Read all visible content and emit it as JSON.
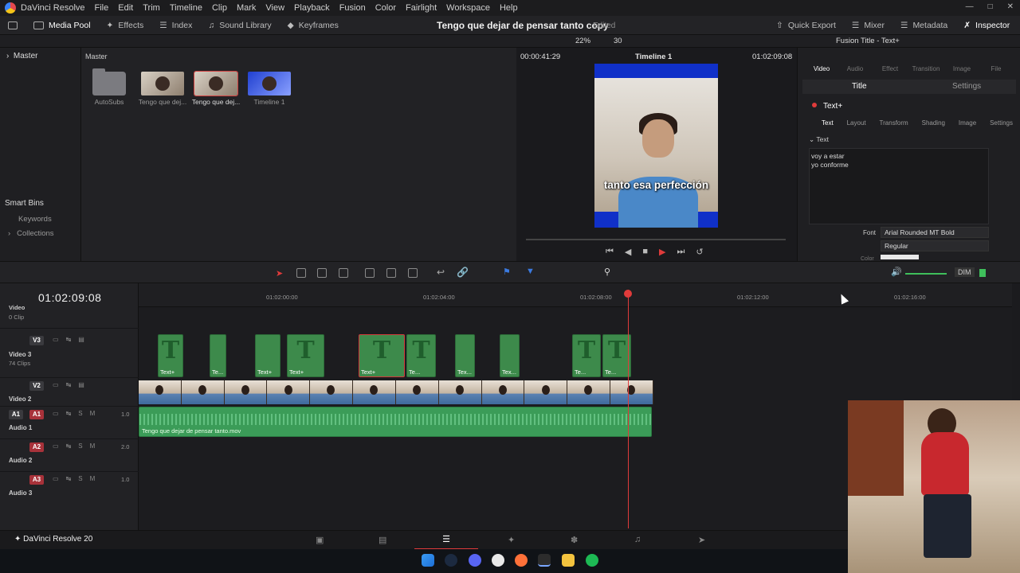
{
  "app": {
    "title": "DaVinci Resolve",
    "brand": "DaVinci Resolve 20"
  },
  "menu": [
    "File",
    "Edit",
    "Trim",
    "Timeline",
    "Clip",
    "Mark",
    "View",
    "Playback",
    "Fusion",
    "Color",
    "Fairlight",
    "Workspace",
    "Help"
  ],
  "toolbar": {
    "media_pool": "Media Pool",
    "effects": "Effects",
    "index": "Index",
    "sound_library": "Sound Library",
    "keyframes": "Keyframes",
    "project_title": "Tengo que dejar de pensar tanto copy",
    "edited": "Edited",
    "quick_export": "Quick Export",
    "mixer": "Mixer",
    "metadata": "Metadata",
    "inspector": "Inspector"
  },
  "viewer_bar": {
    "zoom": "22%",
    "fps": "30",
    "inspector_title": "Fusion Title - Text+"
  },
  "bins": {
    "master": "Master",
    "smart_bins": "Smart Bins",
    "keywords": "Keywords",
    "collections": "Collections"
  },
  "media_pool": {
    "path": "Master",
    "clips": [
      {
        "label": "AutoSubs"
      },
      {
        "label": "Tengo que dej..."
      },
      {
        "label": "Tengo que dej..."
      },
      {
        "label": "Timeline 1"
      }
    ]
  },
  "viewer": {
    "timecode_left": "00:00:41:29",
    "timeline_name": "Timeline 1",
    "timecode_right": "01:02:09:08",
    "caption": "tanto esa perfección"
  },
  "inspector": {
    "tabs": [
      "Video",
      "Audio",
      "Effect",
      "Transition",
      "Image",
      "File"
    ],
    "subtabs": [
      "Title",
      "Settings"
    ],
    "node": "Text+",
    "node_tabs": [
      "Text",
      "Layout",
      "Transform",
      "Shading",
      "Image",
      "Settings"
    ],
    "section": "Text",
    "text_value": "voy a estar\nyo conforme",
    "font_label": "Font",
    "font_value": "Arial Rounded MT Bold",
    "style_value": "Regular",
    "color_label": "Color"
  },
  "timeline": {
    "timecode": "01:02:09:08",
    "ruler": [
      "01:02:00:00",
      "01:02:04:00",
      "01:02:08:00",
      "01:02:12:00",
      "01:02:16:00"
    ],
    "tracks": [
      {
        "id": "V3",
        "name": "Video 3",
        "sub": "74 Clips"
      },
      {
        "id": "V2",
        "name": "Video 2",
        "sub": ""
      },
      {
        "id": "A1",
        "name": "Audio 1",
        "level": "1.0"
      },
      {
        "id": "A2",
        "name": "Audio 2",
        "level": "2.0"
      },
      {
        "id": "A3",
        "name": "Audio 3",
        "level": "1.0"
      }
    ],
    "top_partial": {
      "name": "Video",
      "sub": "0 Clip"
    },
    "text_clips": [
      "Text+",
      "Te...",
      "Text+",
      "Text+",
      "Text+",
      "Te...",
      "Tex...",
      "Tex...",
      "Te...",
      "Te..."
    ],
    "audio_clip": "Tengo que dejar de pensar tanto.mov",
    "dim": "DIM"
  },
  "colors": {
    "accent": "#e03b3b",
    "clip_green": "#3d8a4b",
    "audio_green": "#3b9c58"
  }
}
